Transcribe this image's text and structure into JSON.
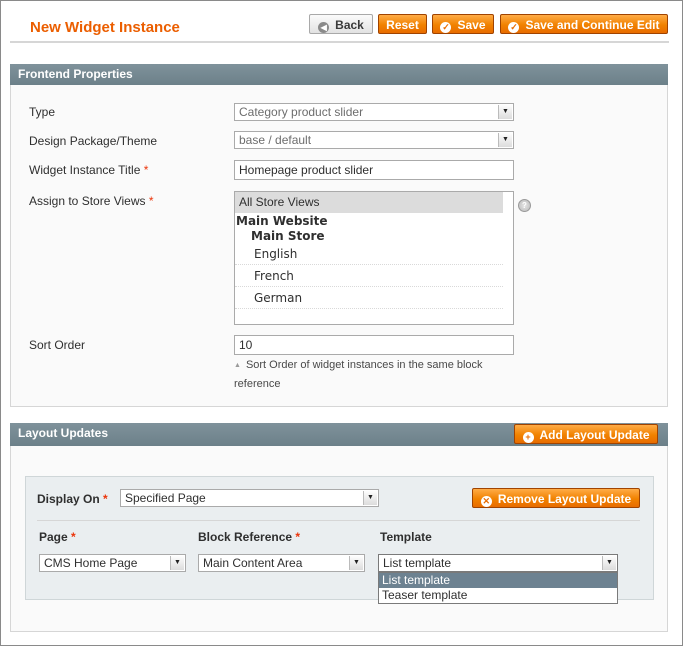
{
  "header": {
    "title": "New Widget Instance",
    "buttons": {
      "back": "Back",
      "reset": "Reset",
      "save": "Save",
      "save_continue": "Save and Continue Edit"
    }
  },
  "frontend": {
    "section_title": "Frontend Properties",
    "type_label": "Type",
    "type_value": "Category product slider",
    "theme_label": "Design Package/Theme",
    "theme_value": "base / default",
    "title_label": "Widget Instance Title",
    "title_value": "Homepage product slider",
    "store_label": "Assign to Store Views",
    "store_views": [
      "All Store Views",
      "Main Website",
      "Main Store",
      "English",
      "French",
      "German"
    ],
    "sort_label": "Sort Order",
    "sort_value": "10",
    "sort_note": "Sort Order of widget instances in the same block reference",
    "required_mark": "*"
  },
  "layout": {
    "section_title": "Layout Updates",
    "add_button": "Add Layout Update",
    "display_on_label": "Display On",
    "display_on_value": "Specified Page",
    "remove_button": "Remove Layout Update",
    "page_label": "Page",
    "page_value": "CMS Home Page",
    "block_label": "Block Reference",
    "block_value": "Main Content Area",
    "template_label": "Template",
    "template_value": "List template",
    "template_options": [
      "List template",
      "Teaser template"
    ]
  },
  "colors": {
    "accent": "#eb5e00",
    "section_bar": "#71858e",
    "button_orange": "#f18200",
    "selected_option": "#6d8291"
  }
}
